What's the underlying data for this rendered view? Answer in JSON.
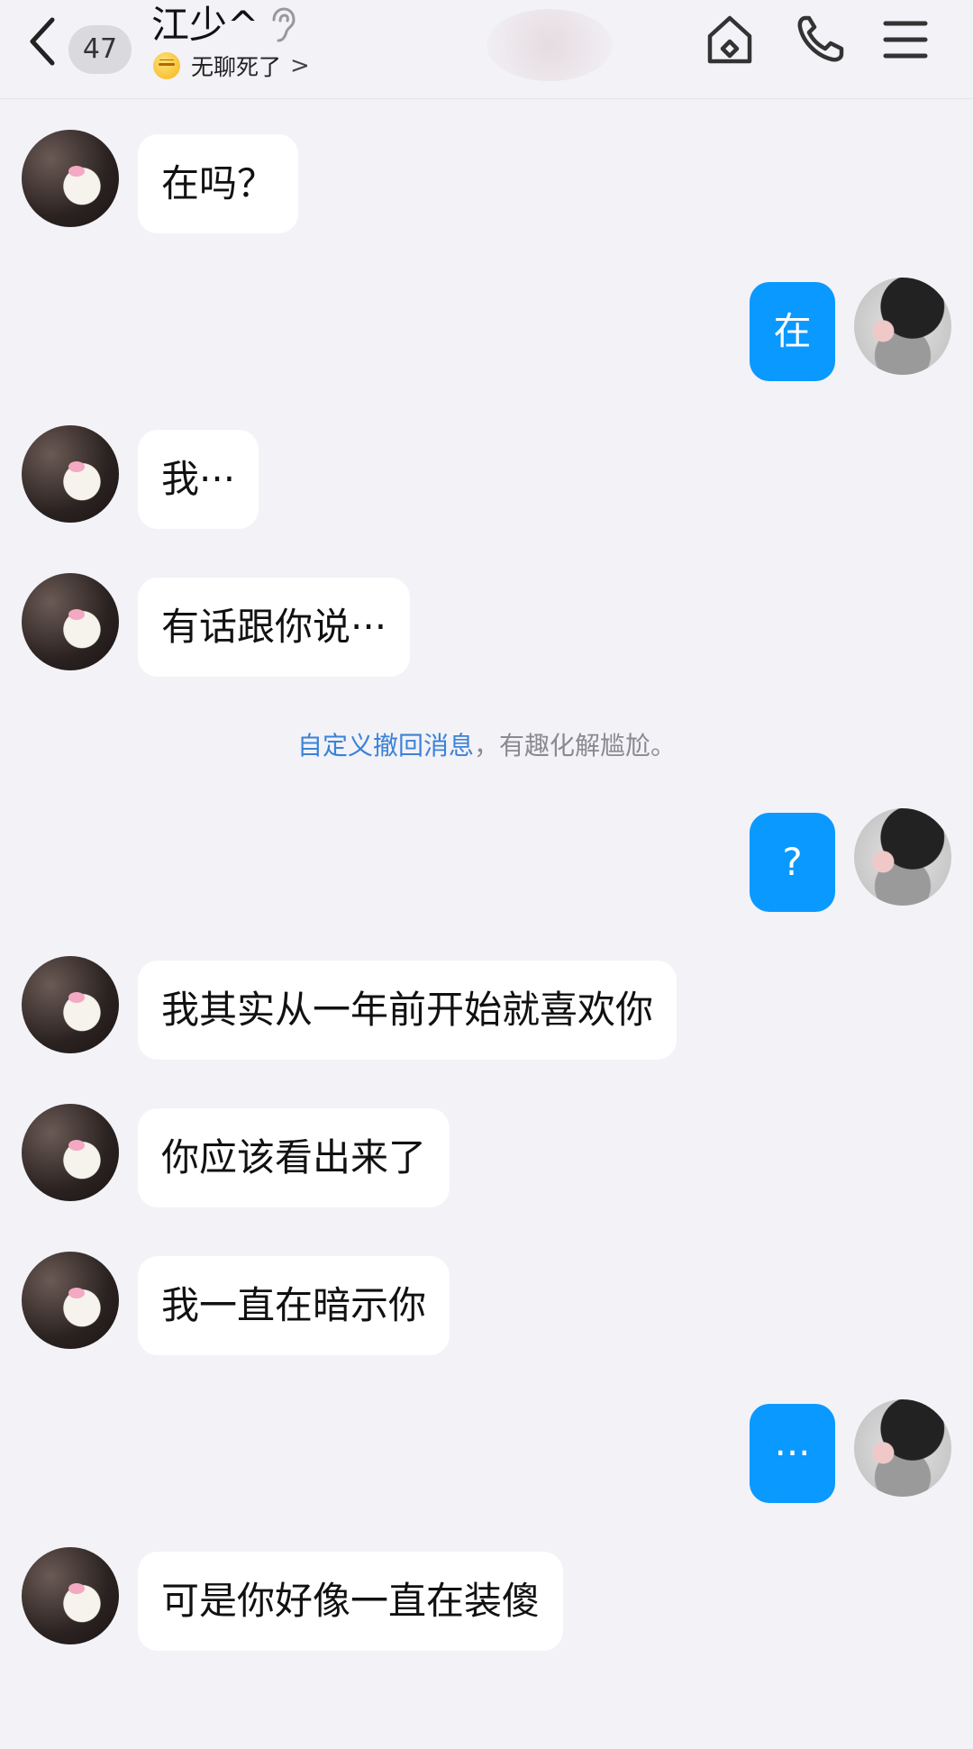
{
  "header": {
    "unread_count": "47",
    "contact_name": "江少^",
    "status_text": "无聊死了",
    "status_chevron": ">",
    "icons": {
      "back": "chevron-left-icon",
      "hearing": "ear-icon",
      "home": "home-icon",
      "phone": "phone-icon",
      "menu": "menu-icon"
    }
  },
  "messages": [
    {
      "side": "incoming",
      "text": "在吗？"
    },
    {
      "side": "outgoing",
      "text": "在"
    },
    {
      "side": "incoming",
      "text": "我···"
    },
    {
      "side": "incoming",
      "text": "有话跟你说···"
    },
    {
      "side": "outgoing",
      "text": "?"
    },
    {
      "side": "incoming",
      "text": "我其实从一年前开始就喜欢你"
    },
    {
      "side": "incoming",
      "text": "你应该看出来了"
    },
    {
      "side": "incoming",
      "text": "我一直在暗示你"
    },
    {
      "side": "outgoing",
      "text": "···"
    },
    {
      "side": "incoming",
      "text": "可是你好像一直在装傻"
    }
  ],
  "recall_tip": {
    "link_text": "自定义撤回消息",
    "rest_text": "，有趣化解尴尬。"
  },
  "colors": {
    "background": "#f2f2f7",
    "outgoing_bubble": "#0a99ff",
    "incoming_bubble": "#ffffff",
    "link": "#3b82d6"
  }
}
